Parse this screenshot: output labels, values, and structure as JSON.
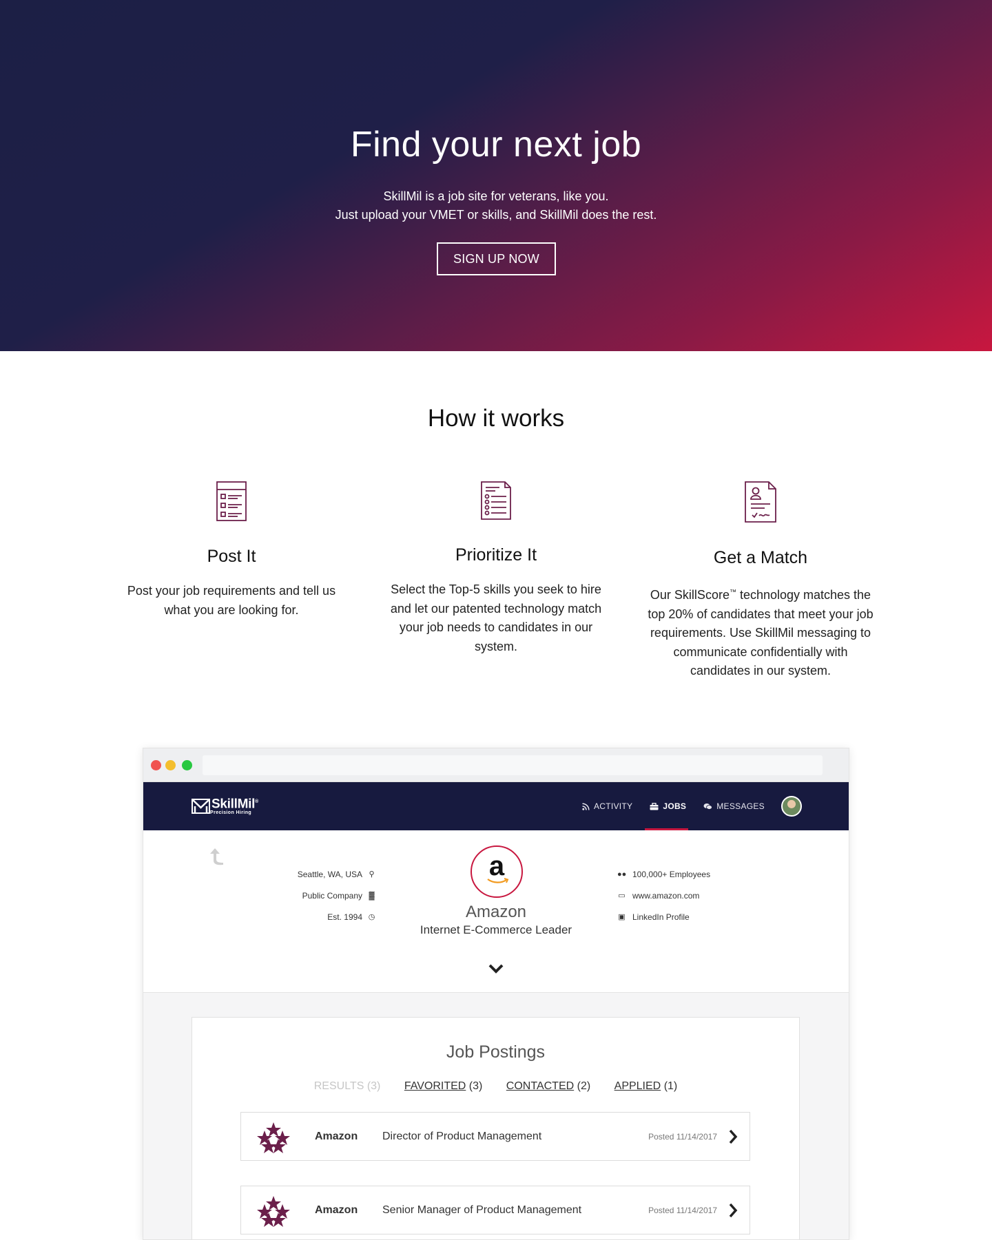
{
  "hero": {
    "title": "Find your next job",
    "subtitle_line1": "SkillMil is a job site for veterans, like you.",
    "subtitle_line2": "Just upload your VMET or skills, and SkillMil does the rest.",
    "cta_label": "SIGN UP NOW",
    "gradient_colors": [
      "#1c1f45",
      "#c8173f"
    ]
  },
  "how_it_works": {
    "title": "How it works",
    "steps": [
      {
        "icon": "checklist-doc-icon",
        "title": "Post It",
        "text": "Post your job requirements and tell us what you are looking for."
      },
      {
        "icon": "list-doc-icon",
        "title": "Prioritize It",
        "text": "Select the Top-5 skills you seek to hire and let our patented technology match your job needs to candidates in our system."
      },
      {
        "icon": "resume-doc-icon",
        "title": "Get a Match",
        "text_before": "Our SkillScore",
        "text_sup": "™",
        "text_after": " technology matches the top 20% of candidates that meet your job requirements. Use SkillMil messaging to communicate confidentially with candidates in our system."
      }
    ]
  },
  "app": {
    "logo_name": "SkillMil",
    "logo_reg": "®",
    "logo_tagline": "Precision Hiring",
    "nav": [
      {
        "icon": "rss-icon",
        "label": "ACTIVITY"
      },
      {
        "icon": "briefcase-icon",
        "label": "JOBS"
      },
      {
        "icon": "chat-icon",
        "label": "MESSAGES"
      }
    ],
    "accent_color": "#c8173f",
    "company": {
      "name": "Amazon",
      "tagline": "Internet E-Commerce Leader",
      "location": "Seattle, WA, USA",
      "type": "Public Company",
      "established": "Est. 1994",
      "employees": "100,000+ Employees",
      "website": "www.amazon.com",
      "linkedin": "LinkedIn Profile",
      "logo_letter": "a"
    },
    "postings": {
      "title": "Job Postings",
      "filters": [
        {
          "label": "RESULTS",
          "count": "(3)"
        },
        {
          "label": "FAVORITED",
          "count": "(3)"
        },
        {
          "label": "CONTACTED",
          "count": "(2)"
        },
        {
          "label": "APPLIED",
          "count": "(1)"
        }
      ],
      "jobs": [
        {
          "company": "Amazon",
          "title": "Director of Product Management",
          "posted": "Posted 11/14/2017"
        },
        {
          "company": "Amazon",
          "title": "Senior Manager of Product Management",
          "posted": "Posted 11/14/2017"
        }
      ]
    }
  }
}
